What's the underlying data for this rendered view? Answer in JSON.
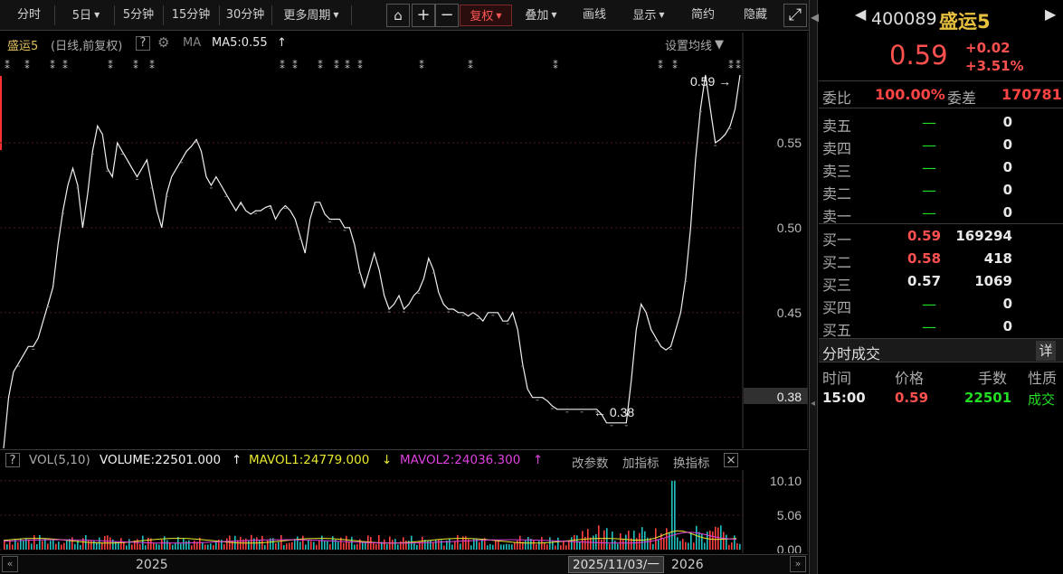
{
  "toolbar": {
    "items": [
      {
        "label": "分时",
        "caret": false
      },
      {
        "label": "5日",
        "caret": true
      },
      {
        "label": "5分钟",
        "caret": false
      },
      {
        "label": "15分钟",
        "caret": false
      },
      {
        "label": "30分钟",
        "caret": false
      },
      {
        "label": "更多周期",
        "caret": true
      }
    ],
    "icons": [
      "lock-icon",
      "plus-icon",
      "minus-icon"
    ],
    "right_items": [
      {
        "label": "复权",
        "caret": true,
        "active": true
      },
      {
        "label": "叠加",
        "caret": true,
        "active": false
      },
      {
        "label": "画线",
        "caret": false,
        "active": false
      },
      {
        "label": "显示",
        "caret": true,
        "active": false
      },
      {
        "label": "简约",
        "caret": false,
        "active": false
      },
      {
        "label": "隐藏",
        "caret": false,
        "active": false
      }
    ]
  },
  "chart_header": {
    "name": "盛运5",
    "period": "(日线,前复权)",
    "help": "?",
    "ma_label": "MA",
    "ma5": "MA5:0.55",
    "arrow_up": "↑",
    "settings": "设置均线"
  },
  "price_annotations": {
    "high": "0.59",
    "low": "0.38",
    "current_tag": "0.38"
  },
  "vol_header": {
    "help": "?",
    "title": "VOL(5,10)",
    "volume": "VOLUME:22501.000",
    "volume_arrow": "↑",
    "mavol1": "MAVOL1:24779.000",
    "mavol1_arrow": "↓",
    "mavol2": "MAVOL2:24036.300",
    "mavol2_arrow": "↑",
    "change_params": "改参数",
    "add_indicator": "加指标",
    "switch_indicator": "换指标",
    "close": "×"
  },
  "bottom_bar": {
    "year_left": "2025",
    "date_tag": "2025/11/03/一",
    "year_right": "2026"
  },
  "quote": {
    "code": "400089",
    "name": "盛运5",
    "price": "0.59",
    "change": "+0.02",
    "change_pct": "+3.51%",
    "weibi_label": "委比",
    "weibi": "100.00%",
    "weicha_label": "委差",
    "weicha": "170781",
    "asks": [
      {
        "label": "卖五",
        "price": "—",
        "vol": "0"
      },
      {
        "label": "卖四",
        "price": "—",
        "vol": "0"
      },
      {
        "label": "卖三",
        "price": "—",
        "vol": "0"
      },
      {
        "label": "卖二",
        "price": "—",
        "vol": "0"
      },
      {
        "label": "卖一",
        "price": "—",
        "vol": "0"
      }
    ],
    "bids": [
      {
        "label": "买一",
        "price": "0.59",
        "vol": "169294",
        "color": "red"
      },
      {
        "label": "买二",
        "price": "0.58",
        "vol": "418",
        "color": "red"
      },
      {
        "label": "买三",
        "price": "0.57",
        "vol": "1069",
        "color": "white"
      },
      {
        "label": "买四",
        "price": "—",
        "vol": "0",
        "color": "green"
      },
      {
        "label": "买五",
        "price": "—",
        "vol": "0",
        "color": "green"
      }
    ],
    "trades_title": "分时成交",
    "detail_btn": "详",
    "trade_headers": [
      "时间",
      "价格",
      "手数",
      "性质"
    ],
    "trades": [
      {
        "time": "15:00",
        "price": "0.59",
        "vol": "22501",
        "nature": "成交"
      }
    ]
  },
  "chart_data": [
    {
      "type": "line",
      "y_ticks": [
        0.4,
        0.45,
        0.5,
        0.55
      ],
      "ylim": [
        0.37,
        0.615
      ],
      "x": [
        0,
        2,
        4,
        6,
        8,
        10,
        12,
        14,
        16,
        18,
        20,
        22,
        24,
        26,
        28,
        30,
        32,
        34,
        36,
        38,
        40,
        42,
        44,
        46,
        48,
        50,
        52,
        54,
        56,
        58,
        60,
        62,
        64,
        66,
        68,
        70,
        72,
        74,
        76,
        78,
        80,
        82,
        84,
        86,
        88,
        90,
        92,
        94,
        96,
        98,
        100,
        102,
        104,
        106,
        108,
        110,
        112,
        114,
        116,
        118,
        120,
        122,
        124,
        126,
        128,
        130,
        132,
        134,
        136,
        138,
        140,
        142,
        144,
        146,
        148,
        150,
        152,
        154,
        156,
        158,
        160,
        162,
        164,
        166,
        168,
        170,
        172,
        174,
        176,
        178,
        180,
        182,
        184,
        186,
        188,
        190,
        192,
        194,
        196,
        198,
        200,
        202,
        204,
        206,
        208,
        210,
        212,
        214,
        216,
        218,
        220,
        222,
        224,
        226,
        228,
        230,
        232,
        234,
        236,
        238,
        240,
        242,
        244,
        246,
        248,
        250,
        252,
        254,
        256,
        258,
        260,
        262,
        264,
        266,
        268,
        270,
        272,
        274,
        276,
        278,
        280,
        282,
        284,
        286,
        288,
        290,
        292,
        294,
        296,
        298
      ],
      "close": [
        0.37,
        0.4,
        0.415,
        0.42,
        0.425,
        0.43,
        0.43,
        0.435,
        0.445,
        0.455,
        0.465,
        0.49,
        0.51,
        0.525,
        0.535,
        0.525,
        0.5,
        0.52,
        0.545,
        0.56,
        0.555,
        0.535,
        0.53,
        0.55,
        0.545,
        0.54,
        0.535,
        0.53,
        0.535,
        0.54,
        0.525,
        0.51,
        0.5,
        0.52,
        0.53,
        0.535,
        0.54,
        0.545,
        0.548,
        0.552,
        0.545,
        0.53,
        0.525,
        0.53,
        0.525,
        0.52,
        0.515,
        0.51,
        0.515,
        0.51,
        0.508,
        0.51,
        0.51,
        0.512,
        0.513,
        0.505,
        0.51,
        0.513,
        0.51,
        0.505,
        0.495,
        0.485,
        0.505,
        0.515,
        0.515,
        0.508,
        0.505,
        0.505,
        0.505,
        0.5,
        0.5,
        0.49,
        0.475,
        0.465,
        0.475,
        0.485,
        0.475,
        0.46,
        0.452,
        0.455,
        0.46,
        0.452,
        0.455,
        0.46,
        0.463,
        0.47,
        0.482,
        0.475,
        0.462,
        0.455,
        0.452,
        0.452,
        0.45,
        0.45,
        0.448,
        0.45,
        0.448,
        0.445,
        0.45,
        0.45,
        0.45,
        0.445,
        0.445,
        0.45,
        0.44,
        0.42,
        0.405,
        0.4,
        0.4,
        0.4,
        0.398,
        0.395,
        0.393,
        0.393,
        0.393,
        0.393,
        0.393,
        0.393,
        0.393,
        0.393,
        0.393,
        0.39,
        0.385,
        0.385,
        0.385,
        0.385,
        0.385,
        0.41,
        0.44,
        0.455,
        0.45,
        0.44,
        0.435,
        0.43,
        0.428,
        0.43,
        0.44,
        0.45,
        0.47,
        0.5,
        0.54,
        0.57,
        0.59,
        0.57,
        0.55,
        0.552,
        0.555,
        0.56,
        0.57,
        0.59
      ]
    },
    {
      "type": "bar",
      "y_ticks": [
        0.0,
        5.06,
        10.1
      ],
      "ylim": [
        0,
        11.4
      ]
    }
  ]
}
